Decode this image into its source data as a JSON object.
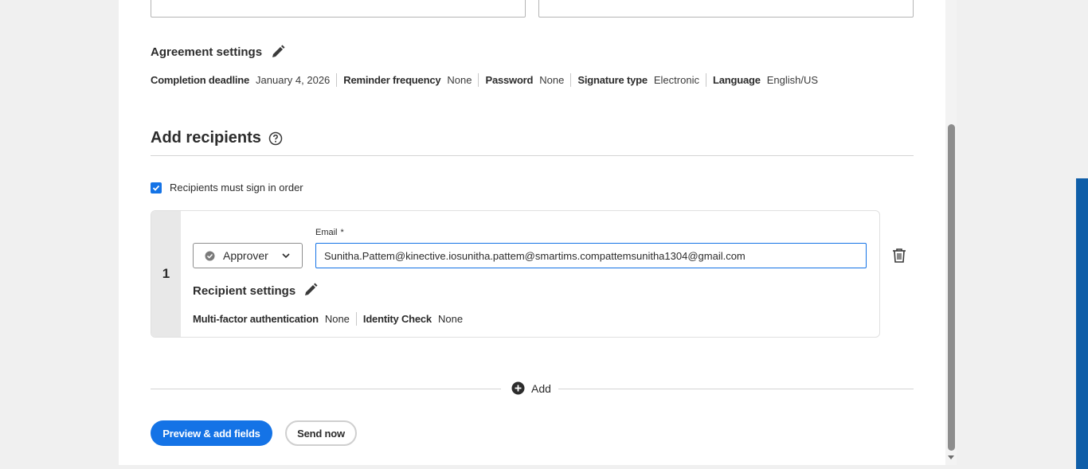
{
  "agreement_settings": {
    "title": "Agreement settings",
    "items": [
      {
        "label": "Completion deadline",
        "value": "January 4, 2026"
      },
      {
        "label": "Reminder frequency",
        "value": "None"
      },
      {
        "label": "Password",
        "value": "None"
      },
      {
        "label": "Signature type",
        "value": "Electronic"
      },
      {
        "label": "Language",
        "value": "English/US"
      }
    ]
  },
  "recipients": {
    "title": "Add recipients",
    "sign_in_order_label": "Recipients must sign in order",
    "sign_in_order_checked": true,
    "list": [
      {
        "number": "1",
        "role": "Approver",
        "email_label": "Email",
        "email_required_mark": "*",
        "email_value": "Sunitha.Pattem@kinective.iosunitha.pattem@smartims.compattemsunitha1304@gmail.com",
        "settings_title": "Recipient settings",
        "settings": [
          {
            "label": "Multi-factor authentication",
            "value": "None"
          },
          {
            "label": "Identity Check",
            "value": "None"
          }
        ]
      }
    ],
    "add_label": "Add"
  },
  "actions": {
    "preview_label": "Preview & add fields",
    "send_label": "Send now"
  },
  "colors": {
    "accent": "#1473e6",
    "strip": "#0f5ea8"
  },
  "icons": {
    "edit": "pencil-icon",
    "help": "question-circle-icon",
    "delete": "trash-icon",
    "add": "plus-circle-icon",
    "role": "check-circle-icon",
    "dropdown": "chevron-down-icon"
  }
}
